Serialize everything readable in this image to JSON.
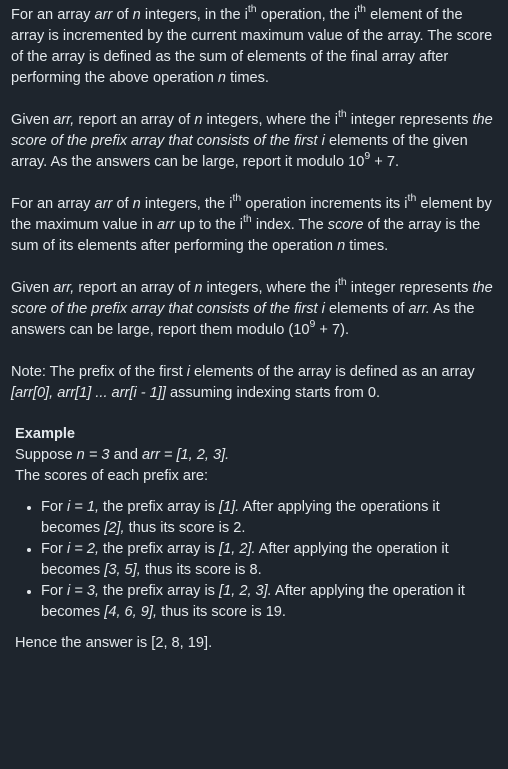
{
  "p1": {
    "a": "For an array ",
    "arr": "arr",
    "b": " of ",
    "n": "n",
    "c": " integers, in the i",
    "sup1": "th",
    "d": " operation, the i",
    "sup2": "th",
    "e": " element of the array is incremented by the current maximum value of the array. The score of the array is defined as the sum of elements of the final array after performing the above operation ",
    "n2": "n",
    "f": " times."
  },
  "p2": {
    "a": "Given ",
    "arr": "arr,",
    "b": " report an array of ",
    "n": "n",
    "c": " integers, where the i",
    "sup": "th",
    "d": " integer represents ",
    "em": "the score of the prefix array that consists of the first i",
    "e": " elements of the given array. As the answers can be large, report it modulo 10",
    "sup9": "9",
    "f": " + 7."
  },
  "p3": {
    "a": "For an array ",
    "arr": "arr",
    "b": " of ",
    "n": "n",
    "c": " integers, the i",
    "sup": "th",
    "d": " operation increments its i",
    "sup2": "th",
    "e": " element by the maximum value in ",
    "arr2": "arr",
    "f": " up to the i",
    "sup3": "th",
    "g": " index. The ",
    "score": "score",
    "h": " of the array is the sum of its elements after performing the operation ",
    "n2": "n",
    "i": " times."
  },
  "p4": {
    "a": "Given ",
    "arr": "arr,",
    "b": " report an array of ",
    "n": "n",
    "c": " integers, where the i",
    "sup": "th",
    "d": " integer represents ",
    "em": "the score of the prefix array that consists of the first i",
    "e": " elements of ",
    "arr2": "arr.",
    "f": " As the answers can be large, report them modulo (10",
    "sup9": "9",
    "g": " + 7)."
  },
  "p5": {
    "a": "Note: The prefix of the first ",
    "i": "i",
    "b": " elements of the array is defined as an array ",
    "em": "[arr[0], arr[1] ... arr[i - 1]]",
    "c": " assuming indexing starts from 0."
  },
  "example": {
    "title": "Example",
    "suppose_a": "Suppose ",
    "suppose_n": "n = 3",
    "suppose_b": " and ",
    "suppose_arr": "arr = [1, 2, 3].",
    "scores_intro": "The scores of each prefix are:",
    "items": [
      {
        "a": "For ",
        "i": "i = 1,",
        "b": " the prefix array is ",
        "prefix": "[1].",
        "c": " After applying the operations it becomes ",
        "result": "[2],",
        "d": " thus its score is 2."
      },
      {
        "a": "For ",
        "i": "i = 2,",
        "b": " the prefix array is ",
        "prefix": "[1, 2].",
        "c": " After applying the operation it becomes ",
        "result": "[3, 5],",
        "d": " thus its score is 8."
      },
      {
        "a": "For ",
        "i": "i = 3,",
        "b": " the prefix array is ",
        "prefix": "[1, 2, 3].",
        "c": " After applying the operation it becomes ",
        "result": "[4, 6, 9],",
        "d": " thus its score is 19."
      }
    ],
    "answer": "Hence the answer is [2, 8, 19]."
  }
}
